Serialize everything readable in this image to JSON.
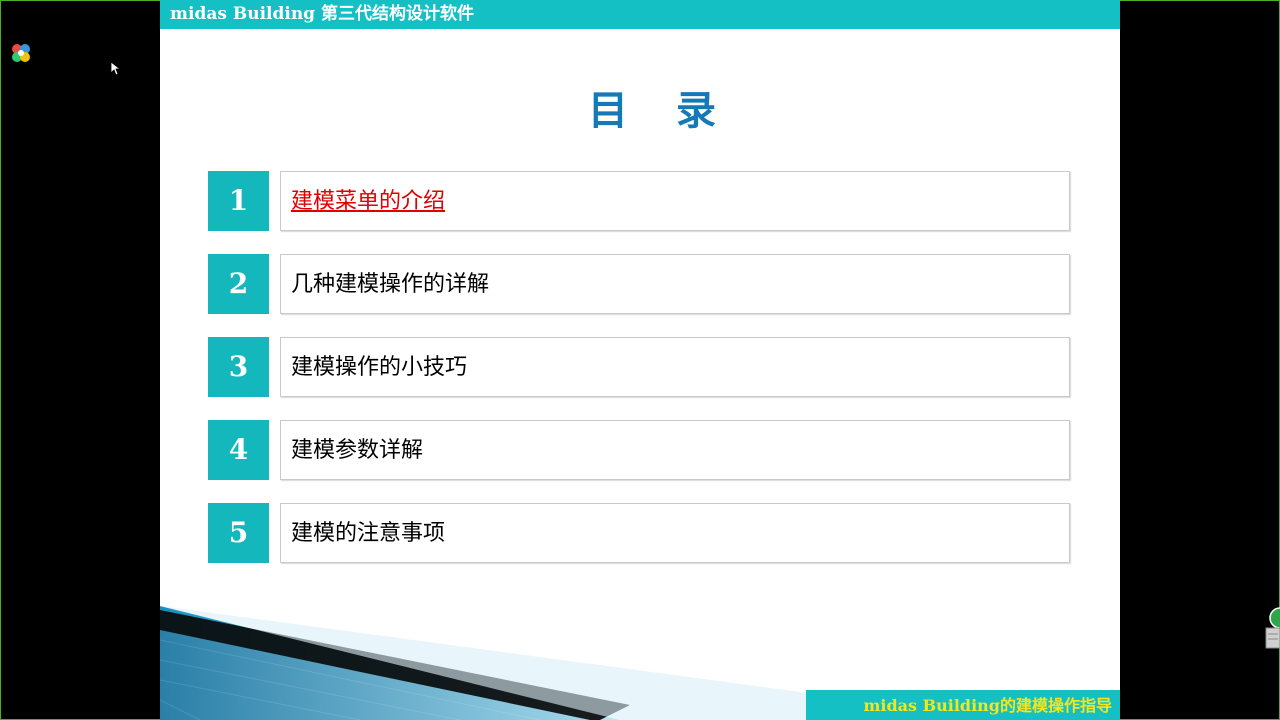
{
  "slide": {
    "header": "midas Building 第三代结构设计软件",
    "title": "目录",
    "footer": "midas Building的建模操作指导",
    "toc": [
      {
        "num": "1",
        "label": "建模菜单的介绍"
      },
      {
        "num": "2",
        "label": "几种建模操作的详解"
      },
      {
        "num": "3",
        "label": "建模操作的小技巧"
      },
      {
        "num": "4",
        "label": "建模参数详解"
      },
      {
        "num": "5",
        "label": "建模的注意事项"
      }
    ]
  },
  "colors": {
    "accent": "#14c0c4",
    "title": "#1479b8",
    "link": "#e00000",
    "footer_text": "#f4e61c"
  },
  "icons": [
    "app-logo-icon",
    "mouse-cursor-icon",
    "side-page-icon"
  ]
}
